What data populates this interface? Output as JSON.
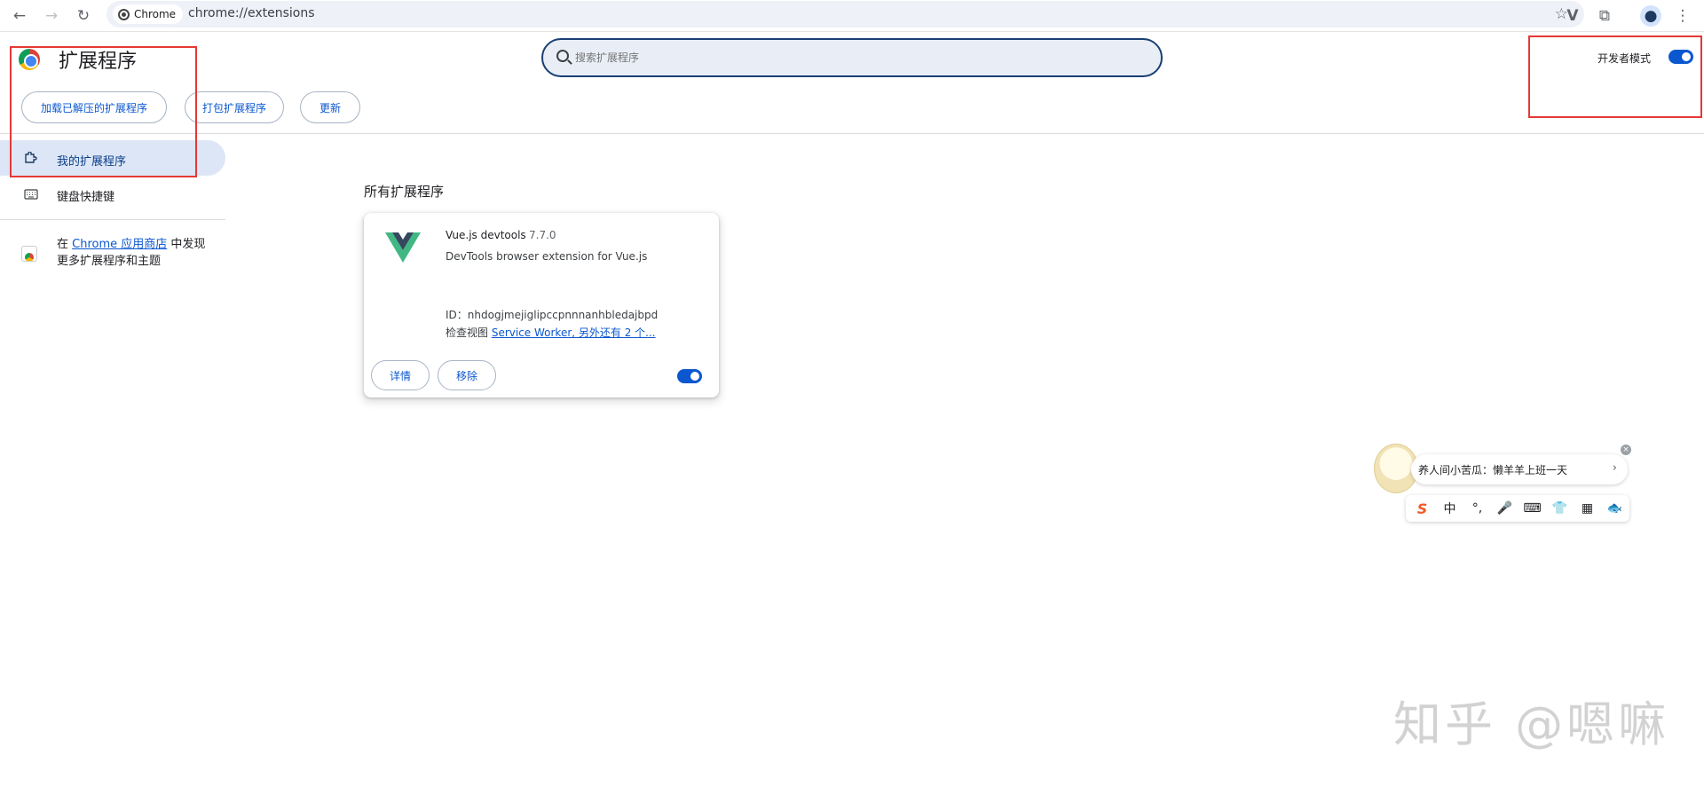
{
  "browser": {
    "chip_label": "Chrome",
    "url": "chrome://extensions"
  },
  "header": {
    "title": "扩展程序",
    "search_placeholder": "搜索扩展程序",
    "dev_mode_label": "开发者模式",
    "dev_mode_on": true
  },
  "actions": {
    "load_unpacked": "加载已解压的扩展程序",
    "pack": "打包扩展程序",
    "update": "更新"
  },
  "sidebar": {
    "items": [
      {
        "label": "我的扩展程序",
        "icon": "puzzle-icon",
        "active": true
      },
      {
        "label": "键盘快捷键",
        "icon": "keyboard-icon",
        "active": false
      }
    ],
    "store_prefix": "在 ",
    "store_link": "Chrome 应用商店",
    "store_suffix": " 中发现",
    "store_line2": "更多扩展程序和主题"
  },
  "main": {
    "section_title": "所有扩展程序",
    "extension": {
      "name": "Vue.js devtools",
      "version": "7.7.0",
      "description": "DevTools browser extension for Vue.js",
      "id_label": "ID：nhdogjmejiglipccpnnnanhbledajbpd",
      "views_label": "检查视图 ",
      "views_link": "Service Worker, 另外还有 2 个...",
      "details_button": "详情",
      "remove_button": "移除",
      "enabled": true
    }
  },
  "ime": {
    "bubble_text": "养人间小苦瓜：懒羊羊上班一天",
    "bubble_arrow": "›",
    "close": "×",
    "tools": [
      "S",
      "中",
      "°,",
      "🎤",
      "⌨",
      "👕",
      "▦",
      "🐟"
    ]
  },
  "watermark": "知乎 @嗯嘛",
  "colors": {
    "accent": "#0b57d0",
    "highlight": "#e53935"
  }
}
